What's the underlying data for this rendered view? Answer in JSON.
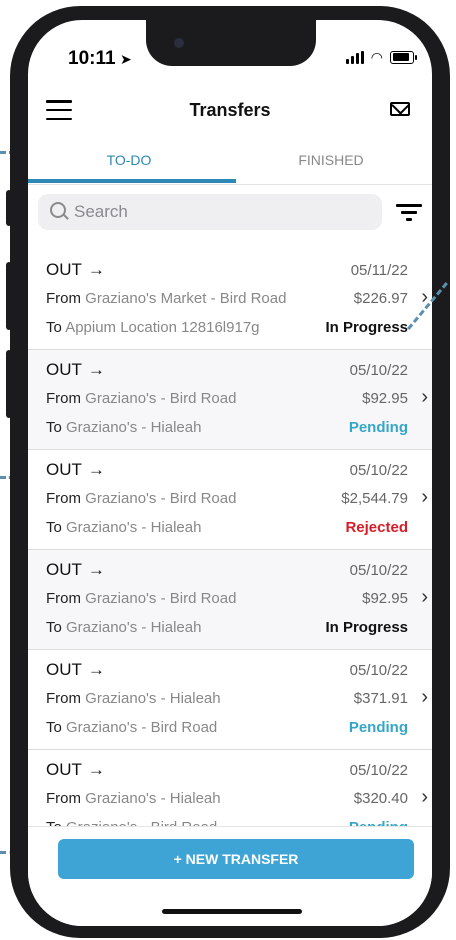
{
  "status_bar": {
    "time": "10:11"
  },
  "app_bar": {
    "title": "Transfers"
  },
  "tabs": [
    {
      "label": "TO-DO",
      "active": true
    },
    {
      "label": "FINISHED",
      "active": false
    }
  ],
  "search": {
    "placeholder": "Search"
  },
  "transfers": [
    {
      "direction": "OUT",
      "date": "05/11/22",
      "from_prefix": "From",
      "from": "Graziano's Market - Bird Road",
      "amount": "$226.97",
      "to_prefix": "To",
      "to": "Appium Location 12816l917g",
      "status": "In Progress"
    },
    {
      "direction": "OUT",
      "date": "05/10/22",
      "from_prefix": "From",
      "from": "Graziano's - Bird Road",
      "amount": "$92.95",
      "to_prefix": "To",
      "to": "Graziano's - Hialeah",
      "status": "Pending"
    },
    {
      "direction": "OUT",
      "date": "05/10/22",
      "from_prefix": "From",
      "from": "Graziano's - Bird Road",
      "amount": "$2,544.79",
      "to_prefix": "To",
      "to": "Graziano's - Hialeah",
      "status": "Rejected"
    },
    {
      "direction": "OUT",
      "date": "05/10/22",
      "from_prefix": "From",
      "from": "Graziano's - Bird Road",
      "amount": "$92.95",
      "to_prefix": "To",
      "to": "Graziano's - Hialeah",
      "status": "In Progress"
    },
    {
      "direction": "OUT",
      "date": "05/10/22",
      "from_prefix": "From",
      "from": "Graziano's - Hialeah",
      "amount": "$371.91",
      "to_prefix": "To",
      "to": "Graziano's - Bird Road",
      "status": "Pending"
    },
    {
      "direction": "OUT",
      "date": "05/10/22",
      "from_prefix": "From",
      "from": "Graziano's - Hialeah",
      "amount": "$320.40",
      "to_prefix": "To",
      "to": "Graziano's - Bird Road",
      "status": "Pending"
    }
  ],
  "footer": {
    "new_transfer_label": "+ NEW TRANSFER"
  },
  "colors": {
    "accent": "#2e88b5",
    "button": "#3ea4d6",
    "pending": "#35a6c8",
    "rejected": "#d61e28",
    "in_progress": "#111111"
  },
  "icons": [
    "location-arrow-icon",
    "signal-icon",
    "wifi-icon",
    "battery-icon",
    "menu-icon",
    "mail-icon",
    "search-icon",
    "filter-icon",
    "arrow-right-icon",
    "chevron-right-icon"
  ]
}
